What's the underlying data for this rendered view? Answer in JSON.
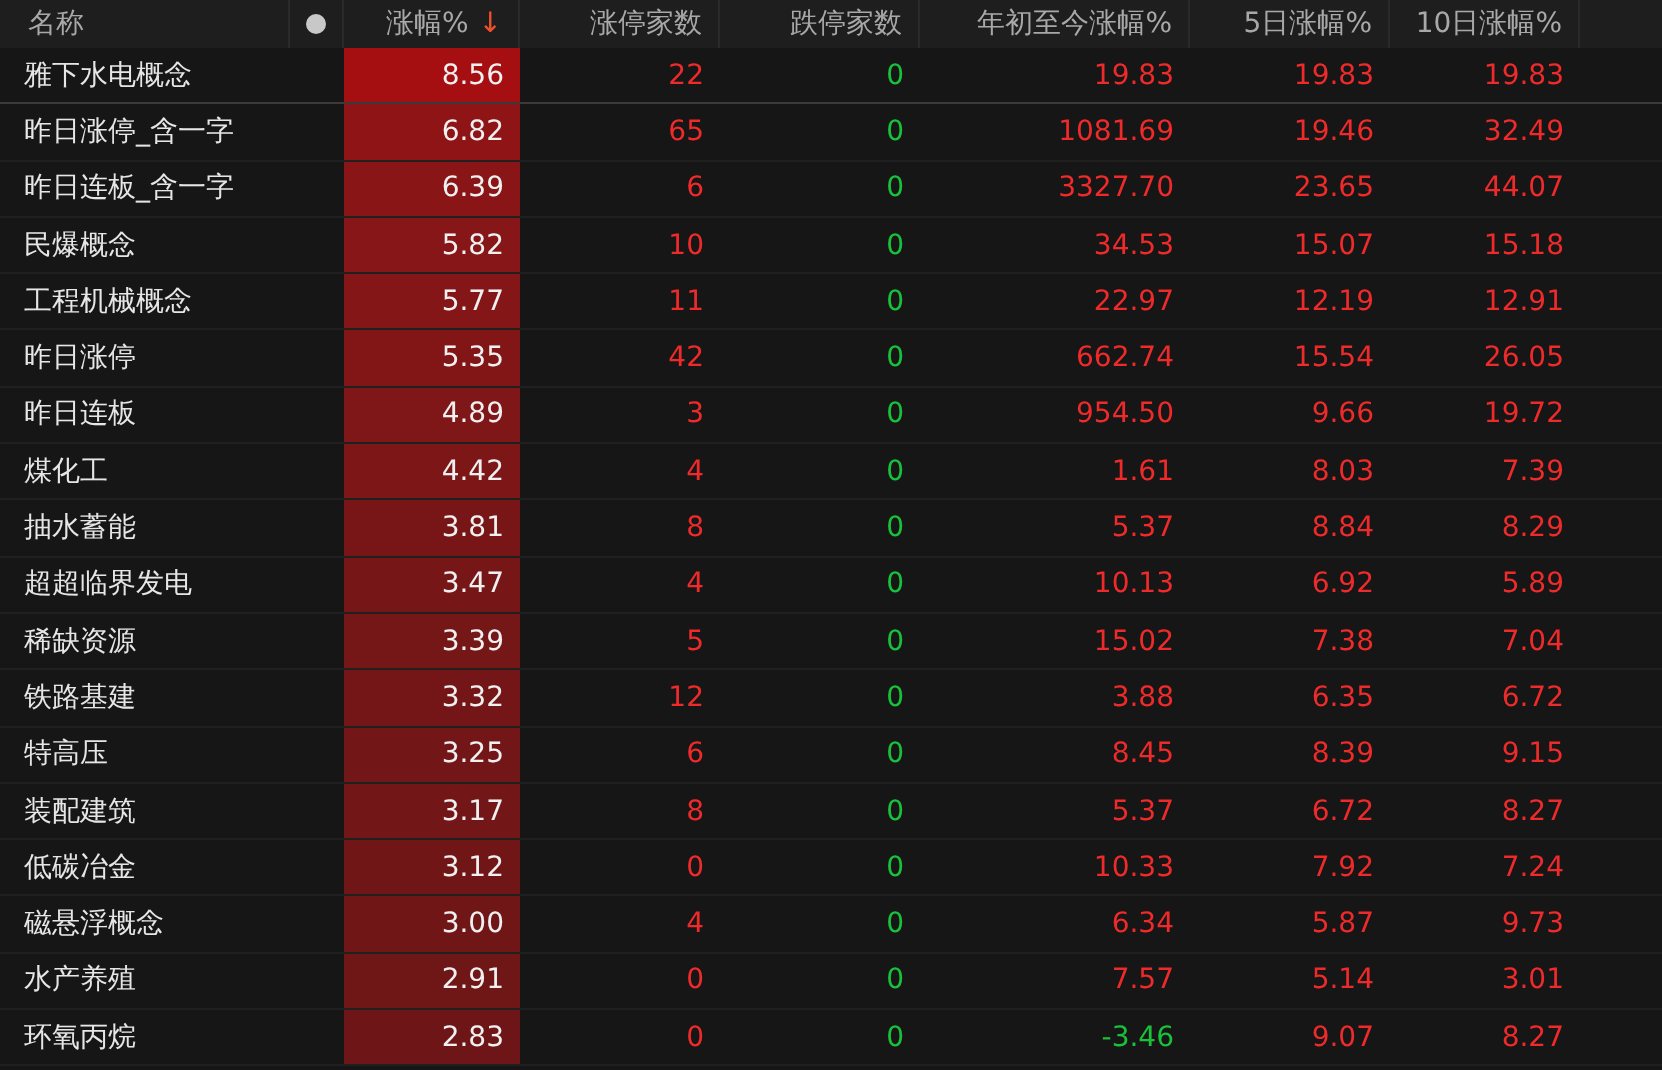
{
  "table": {
    "columns": [
      {
        "label": "名称"
      },
      {
        "label": "涨幅%",
        "sort_indicator": "↓"
      },
      {
        "label": "涨停家数"
      },
      {
        "label": "跌停家数"
      },
      {
        "label": "年初至今涨幅%"
      },
      {
        "label": "5日涨幅%"
      },
      {
        "label": "10日涨幅%"
      }
    ],
    "rows": [
      {
        "name": "雅下水电概念",
        "change": "8.56",
        "color": "#a50f12",
        "limit_up": "22",
        "limit_down": "0",
        "ytd": {
          "value": "19.83",
          "color": "#ee2a2a"
        },
        "d5": "19.83",
        "d10": "19.83"
      },
      {
        "name": "昨日涨停_含一字",
        "change": "6.82",
        "color": "#8e1416",
        "limit_up": "65",
        "limit_down": "0",
        "ytd": {
          "value": "1081.69",
          "color": "#ee2a2a"
        },
        "d5": "19.46",
        "d10": "32.49"
      },
      {
        "name": "昨日连板_含一字",
        "change": "6.39",
        "color": "#8a1517",
        "limit_up": "6",
        "limit_down": "0",
        "ytd": {
          "value": "3327.70",
          "color": "#ee2a2a"
        },
        "d5": "23.65",
        "d10": "44.07"
      },
      {
        "name": "民爆概念",
        "change": "5.82",
        "color": "#861617",
        "limit_up": "10",
        "limit_down": "0",
        "ytd": {
          "value": "34.53",
          "color": "#ee2a2a"
        },
        "d5": "15.07",
        "d10": "15.18"
      },
      {
        "name": "工程机械概念",
        "change": "5.77",
        "color": "#851617",
        "limit_up": "11",
        "limit_down": "0",
        "ytd": {
          "value": "22.97",
          "color": "#ee2a2a"
        },
        "d5": "12.19",
        "d10": "12.91"
      },
      {
        "name": "昨日涨停",
        "change": "5.35",
        "color": "#821617",
        "limit_up": "42",
        "limit_down": "0",
        "ytd": {
          "value": "662.74",
          "color": "#ee2a2a"
        },
        "d5": "15.54",
        "d10": "26.05"
      },
      {
        "name": "昨日连板",
        "change": "4.89",
        "color": "#7f1617",
        "limit_up": "3",
        "limit_down": "0",
        "ytd": {
          "value": "954.50",
          "color": "#ee2a2a"
        },
        "d5": "9.66",
        "d10": "19.72"
      },
      {
        "name": "煤化工",
        "change": "4.42",
        "color": "#7c1617",
        "limit_up": "4",
        "limit_down": "0",
        "ytd": {
          "value": "1.61",
          "color": "#ee2a2a"
        },
        "d5": "8.03",
        "d10": "7.39"
      },
      {
        "name": "抽水蓄能",
        "change": "3.81",
        "color": "#781617",
        "limit_up": "8",
        "limit_down": "0",
        "ytd": {
          "value": "5.37",
          "color": "#ee2a2a"
        },
        "d5": "8.84",
        "d10": "8.29"
      },
      {
        "name": "超超临界发电",
        "change": "3.47",
        "color": "#761617",
        "limit_up": "4",
        "limit_down": "0",
        "ytd": {
          "value": "10.13",
          "color": "#ee2a2a"
        },
        "d5": "6.92",
        "d10": "5.89"
      },
      {
        "name": "稀缺资源",
        "change": "3.39",
        "color": "#751617",
        "limit_up": "5",
        "limit_down": "0",
        "ytd": {
          "value": "15.02",
          "color": "#ee2a2a"
        },
        "d5": "7.38",
        "d10": "7.04"
      },
      {
        "name": "铁路基建",
        "change": "3.32",
        "color": "#741617",
        "limit_up": "12",
        "limit_down": "0",
        "ytd": {
          "value": "3.88",
          "color": "#ee2a2a"
        },
        "d5": "6.35",
        "d10": "6.72"
      },
      {
        "name": "特高压",
        "change": "3.25",
        "color": "#731617",
        "limit_up": "6",
        "limit_down": "0",
        "ytd": {
          "value": "8.45",
          "color": "#ee2a2a"
        },
        "d5": "8.39",
        "d10": "9.15"
      },
      {
        "name": "装配建筑",
        "change": "3.17",
        "color": "#721617",
        "limit_up": "8",
        "limit_down": "0",
        "ytd": {
          "value": "5.37",
          "color": "#ee2a2a"
        },
        "d5": "6.72",
        "d10": "8.27"
      },
      {
        "name": "低碳冶金",
        "change": "3.12",
        "color": "#711617",
        "limit_up": "0",
        "limit_down": "0",
        "ytd": {
          "value": "10.33",
          "color": "#ee2a2a"
        },
        "d5": "7.92",
        "d10": "7.24"
      },
      {
        "name": "磁悬浮概念",
        "change": "3.00",
        "color": "#701617",
        "limit_up": "4",
        "limit_down": "0",
        "ytd": {
          "value": "6.34",
          "color": "#ee2a2a"
        },
        "d5": "5.87",
        "d10": "9.73"
      },
      {
        "name": "水产养殖",
        "change": "2.91",
        "color": "#6f1617",
        "limit_up": "0",
        "limit_down": "0",
        "ytd": {
          "value": "7.57",
          "color": "#ee2a2a"
        },
        "d5": "5.14",
        "d10": "3.01"
      },
      {
        "name": "环氧丙烷",
        "change": "2.83",
        "color": "#6e1617",
        "limit_up": "0",
        "limit_down": "0",
        "ytd": {
          "value": "-3.46",
          "color": "#19c03a"
        },
        "d5": "9.07",
        "d10": "8.27"
      }
    ]
  }
}
